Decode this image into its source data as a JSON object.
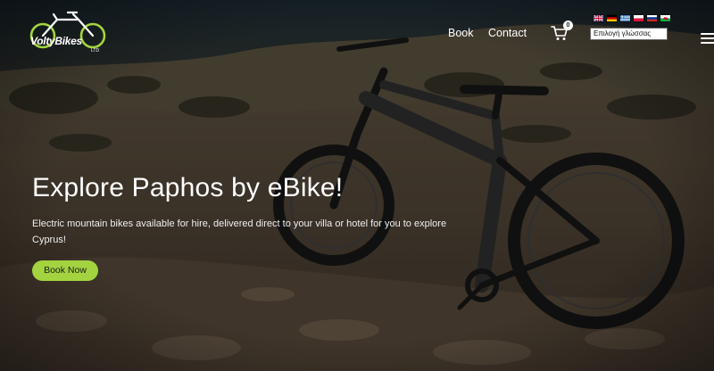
{
  "brand": {
    "logo_text": "VoltyBikes",
    "logo_suffix": "LTD",
    "accent_color": "#a3d43f"
  },
  "nav": {
    "items": [
      {
        "label": "Book"
      },
      {
        "label": "Contact"
      }
    ]
  },
  "cart": {
    "icon": "cart-icon",
    "count": "0"
  },
  "language": {
    "flags": [
      "uk-flag-icon",
      "germany-flag-icon",
      "greece-flag-icon",
      "poland-flag-icon",
      "russia-flag-icon",
      "wales-flag-icon"
    ],
    "select_value": "Επιλογή γλώσσας"
  },
  "menu": {
    "icon": "hamburger-menu-icon"
  },
  "hero": {
    "headline": "Explore Paphos by eBike!",
    "subtext": "Electric mountain bikes available for hire, delivered direct to your villa or hotel for you to explore Cyprus!",
    "cta_label": "Book Now",
    "background": "e-mountain-bike-on-rocky-hillside-by-sea"
  }
}
